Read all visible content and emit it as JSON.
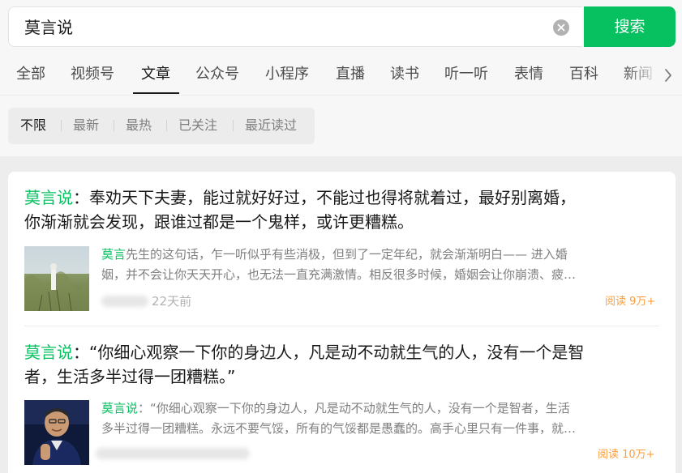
{
  "search": {
    "query": "莫言说",
    "button_label": "搜索"
  },
  "tabs": [
    {
      "label": "全部"
    },
    {
      "label": "视频号"
    },
    {
      "label": "文章",
      "active": true
    },
    {
      "label": "公众号"
    },
    {
      "label": "小程序"
    },
    {
      "label": "直播"
    },
    {
      "label": "读书"
    },
    {
      "label": "听一听"
    },
    {
      "label": "表情"
    },
    {
      "label": "百科"
    },
    {
      "label": "新闻"
    }
  ],
  "filters": [
    {
      "label": "不限",
      "active": true
    },
    {
      "label": "最新"
    },
    {
      "label": "最热"
    },
    {
      "label": "已关注"
    },
    {
      "label": "最近读过"
    }
  ],
  "articles": [
    {
      "title_highlight": "莫言说",
      "title_line1_rest": "：奉劝天下夫妻，能过就好好过，不能过也得将就着过，最好别离婚，",
      "title_line2": "你渐渐就会发现，跟谁过都是一个鬼样，或许更糟糕。",
      "summary_highlight": "莫言",
      "summary_line1_rest": "先生的这句话，乍一听似乎有些消极，但到了一定年纪，就会渐渐明白—— 进入婚",
      "summary_line2": "姻，并不会让你天天开心，也无法一直充满激情。相反很多时候，婚姻会让你崩溃、疲…",
      "time": "22天前",
      "read_count": "阅读 9万+"
    },
    {
      "title_highlight": "莫言说",
      "title_line1_rest": "：“你细心观察一下你的身边人，凡是动不动就生气的人，没有一个是智",
      "title_line2": "者，生活多半过得一团糟糕。”",
      "summary_highlight": "莫言说",
      "summary_line1_rest": "：“你细心观察一下你的身边人，凡是动不动就生气的人，没有一个是智者，生活",
      "summary_line2": "多半过得一团糟糕。永远不要气馁，所有的气馁都是愚蠢的。高手心里只有一件事，就…",
      "read_count": "阅读 10万+"
    }
  ],
  "colors": {
    "accent": "#07c160",
    "read_count": "#fa9d3b",
    "muted_text": "#7f7f7f"
  },
  "icons": {
    "clear": "clear-icon",
    "more_tabs": "chevron-right-icon"
  }
}
